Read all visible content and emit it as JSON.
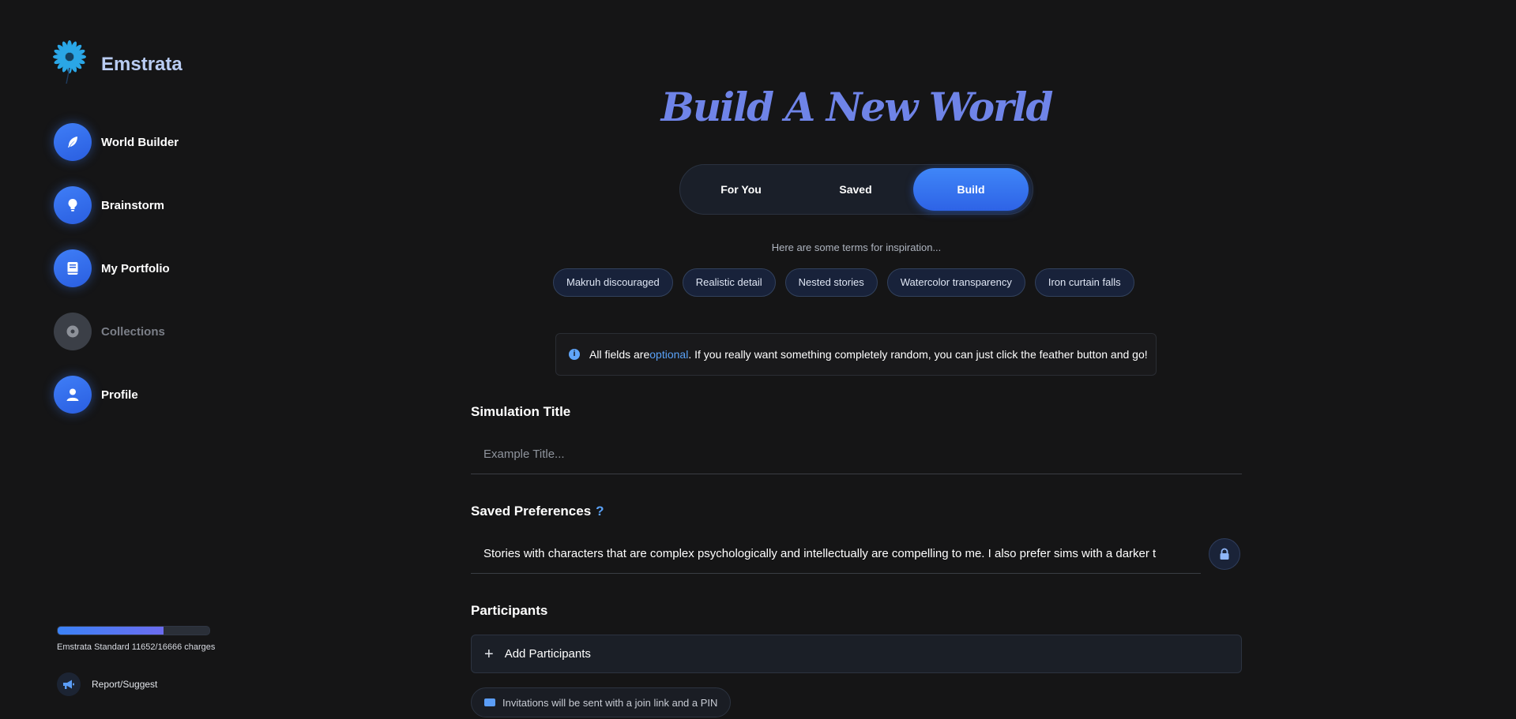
{
  "brand": {
    "name": "Emstrata"
  },
  "sidebar": {
    "items": [
      {
        "label": "World Builder",
        "icon": "feather-icon",
        "enabled": true
      },
      {
        "label": "Brainstorm",
        "icon": "lightbulb-icon",
        "enabled": true
      },
      {
        "label": "My Portfolio",
        "icon": "book-icon",
        "enabled": true
      },
      {
        "label": "Collections",
        "icon": "disc-icon",
        "enabled": false
      },
      {
        "label": "Profile",
        "icon": "user-icon",
        "enabled": true
      }
    ],
    "usage": {
      "plan_text": "Emstrata Standard 11652/16666 charges",
      "fraction": 0.699
    },
    "report_label": "Report/Suggest"
  },
  "main": {
    "title": "Build A New World",
    "tabs": [
      {
        "label": "For You",
        "active": false
      },
      {
        "label": "Saved",
        "active": false
      },
      {
        "label": "Build",
        "active": true
      }
    ],
    "inspiration_text": "Here are some terms for inspiration...",
    "chips": [
      "Makruh discouraged",
      "Realistic detail",
      "Nested stories",
      "Watercolor transparency",
      "Iron curtain falls"
    ],
    "info": {
      "prefix": "All fields are ",
      "link": "optional",
      "suffix": ". If you really want something completely random, you can just click the feather button and go!"
    },
    "simulation_title": {
      "label": "Simulation Title",
      "placeholder": "Example Title..."
    },
    "saved_preferences": {
      "label": "Saved Preferences",
      "help": "?",
      "value": "Stories with characters that are complex psychologically and intellectually are compelling to me. I also prefer sims with a darker t"
    },
    "participants": {
      "label": "Participants",
      "add_label": "Add Participants"
    },
    "invite_note": "Invitations will be sent with a join link and a PIN"
  },
  "colors": {
    "accent": "#3b82f6",
    "title": "#6f84e8",
    "link": "#5aa2f8",
    "background": "#151516"
  }
}
